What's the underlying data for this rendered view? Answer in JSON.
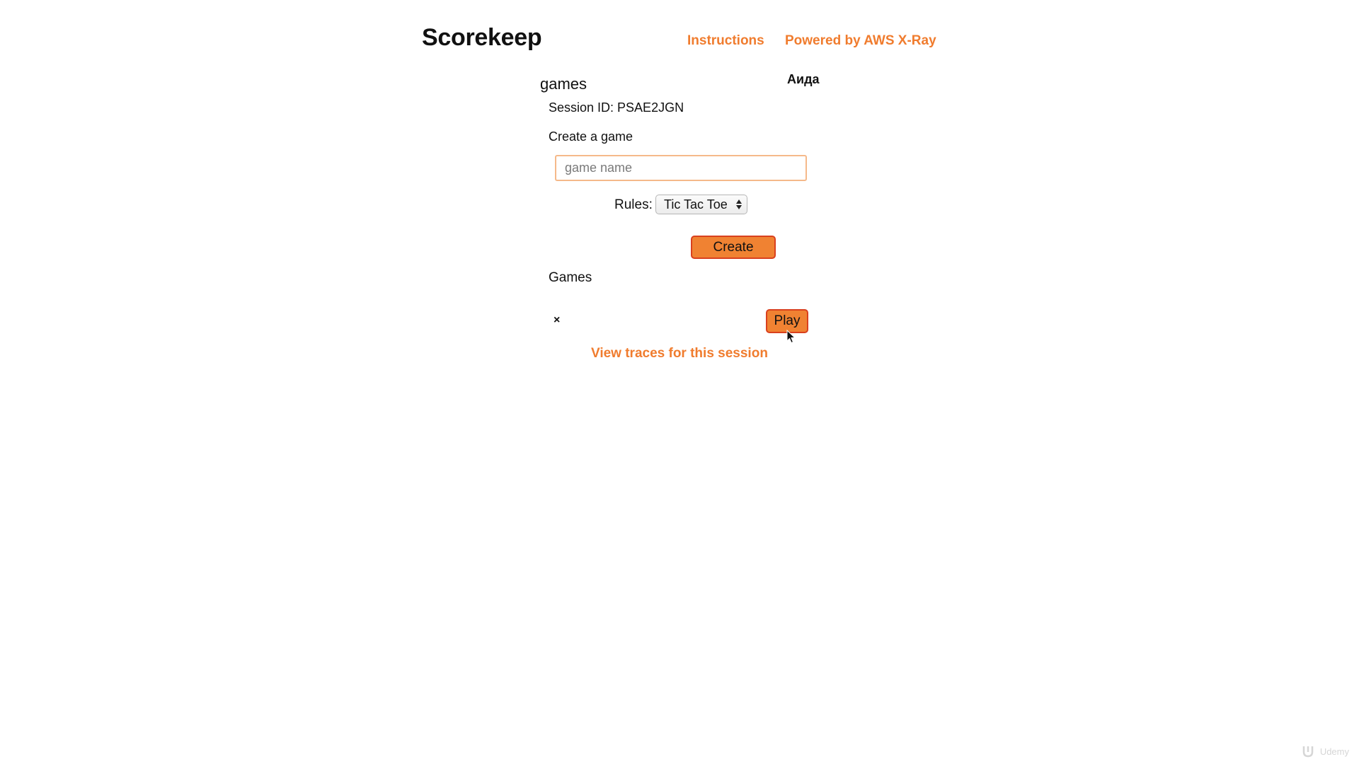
{
  "header": {
    "title": "Scorekeep",
    "nav": {
      "instructions": "Instructions",
      "powered_by": "Powered by AWS X-Ray"
    }
  },
  "user": {
    "name": "Аида"
  },
  "main": {
    "section_heading": "games",
    "session_id": "Session ID: PSAE2JGN",
    "create_label": "Create a game",
    "game_name_input": {
      "value": "",
      "placeholder": "game name"
    },
    "rules": {
      "label": "Rules:",
      "selected": "Tic Tac Toe"
    },
    "create_button": "Create",
    "games_label": "Games",
    "games": [
      {
        "name": "",
        "delete_symbol": "×",
        "play_label": "Play"
      }
    ],
    "view_traces": "View traces for this session"
  },
  "watermark": {
    "text": "Udemy"
  },
  "colors": {
    "accent": "#f07c2e",
    "button_fill": "#f08232",
    "button_border": "#d9401e",
    "input_border": "#f5b98a"
  },
  "icons": {
    "select": "up-down-arrows-icon",
    "delete": "close-icon",
    "cursor": "mouse-pointer-icon",
    "watermark": "udemy-logo-icon"
  }
}
